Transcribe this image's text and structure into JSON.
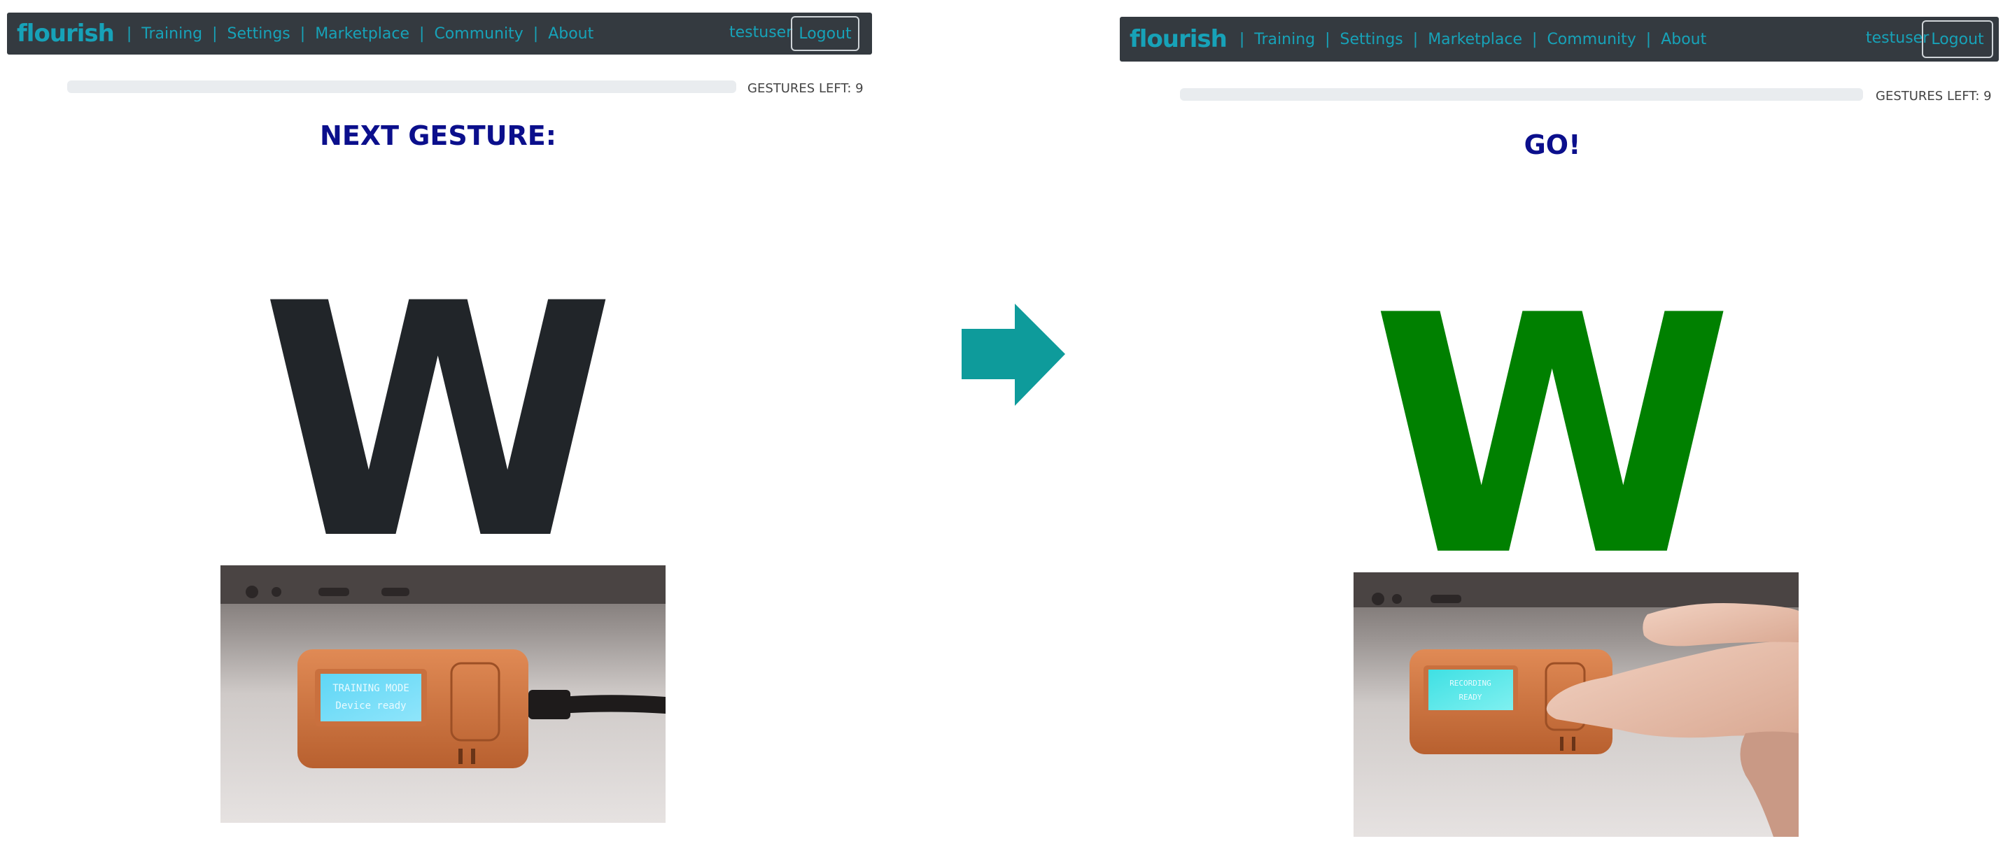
{
  "left_panel": {
    "brand": "flourish",
    "nav": [
      "Training",
      "Settings",
      "Marketplace",
      "Community",
      "About"
    ],
    "username": "testuser",
    "logout_label": "Logout",
    "gestures_left": "GESTURES LEFT: 9",
    "progress": 0,
    "heading": "NEXT GESTURE:",
    "gesture_letter": "W",
    "letter_color": "#212529",
    "device_screen_line1": "TRAINING MODE",
    "device_screen_line2": "Device ready"
  },
  "right_panel": {
    "brand": "flourish",
    "nav": [
      "Training",
      "Settings",
      "Marketplace",
      "Community",
      "About"
    ],
    "username": "testuser",
    "logout_label": "Logout",
    "gestures_left": "GESTURES LEFT: 9",
    "progress": 0,
    "heading": "GO!",
    "gesture_letter": "W",
    "letter_color": "#008000",
    "device_screen_line1": "RECORDING",
    "device_screen_line2": "READY"
  },
  "colors": {
    "navbar_bg": "#343a40",
    "accent": "#17a2b8",
    "heading": "#0b0f8c",
    "arrow": "#0e9b9b"
  },
  "icons": {
    "transition_arrow": "right-arrow-icon"
  }
}
